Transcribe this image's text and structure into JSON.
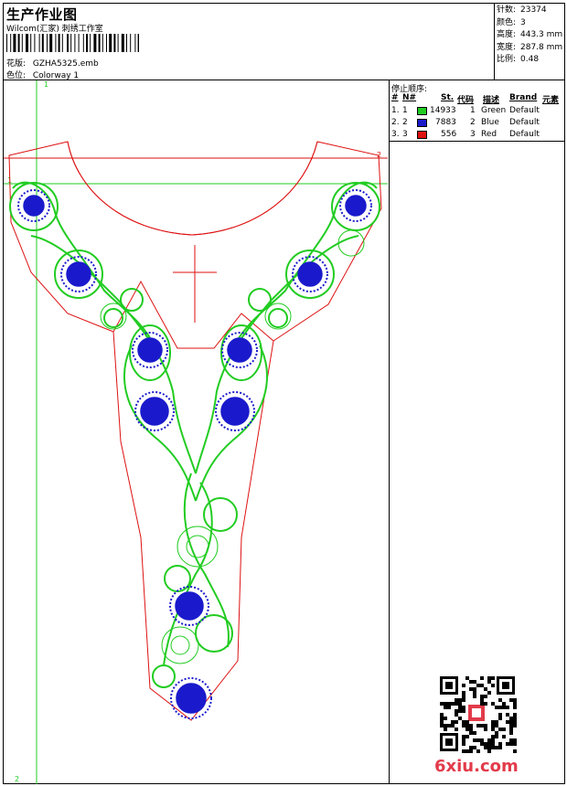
{
  "header": {
    "title": "生产作业图",
    "subtitle": "Wilcom(汇家) 刺绣工作室",
    "design_label": "花版:",
    "design_value": "GZHA5325.emb",
    "colorway_label": "色位:",
    "colorway_value": "Colorway 1"
  },
  "stats": [
    {
      "label": "针数:",
      "value": "23374"
    },
    {
      "label": "颜色:",
      "value": "3"
    },
    {
      "label": "高度:",
      "value": "443.3 mm"
    },
    {
      "label": "宽度:",
      "value": "287.8 mm"
    },
    {
      "label": "比例:",
      "value": "0.48"
    }
  ],
  "stop_sequence": {
    "title": "停止顺序:",
    "columns": [
      "#",
      "N#",
      "St.",
      "代码",
      "描述",
      "Brand",
      "元素"
    ],
    "rows": [
      {
        "num": "1.",
        "n": "1",
        "color": "#22cc22",
        "stitches": "14933",
        "code": "1",
        "desc": "Green",
        "brand": "Default"
      },
      {
        "num": "2.",
        "n": "2",
        "color": "#1a1acc",
        "stitches": "7883",
        "code": "2",
        "desc": "Blue",
        "brand": "Default"
      },
      {
        "num": "3.",
        "n": "3",
        "color": "#dd1111",
        "stitches": "556",
        "code": "3",
        "desc": "Red",
        "brand": "Default"
      }
    ]
  },
  "guides": {
    "green_top": "1",
    "green_left_top": "1",
    "green_left_bottom": "2",
    "red_right": "2"
  },
  "colors": {
    "green": "#22cc22",
    "blue": "#1a1acc",
    "red": "#dd1111"
  },
  "watermark": "6xiu.com"
}
